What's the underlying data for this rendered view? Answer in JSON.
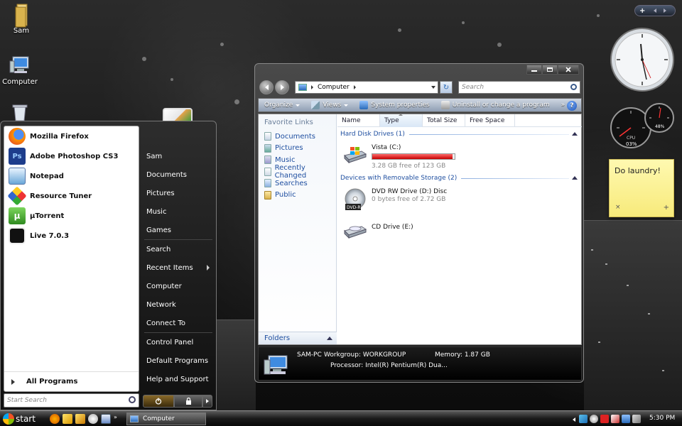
{
  "desktop": {
    "icons": [
      {
        "label": "Sam"
      },
      {
        "label": "Computer"
      }
    ]
  },
  "start_menu": {
    "pinned": [
      {
        "label": "Mozilla Firefox",
        "icon": "firefox-icon",
        "color": "#e66000"
      },
      {
        "label": "Adobe Photoshop CS3",
        "icon": "photoshop-icon",
        "color": "#1d3d8c"
      },
      {
        "label": "Notepad",
        "icon": "notepad-icon",
        "color": "#6aa7d8"
      },
      {
        "label": "Resource Tuner",
        "icon": "resource-tuner-icon",
        "color": "#d33"
      },
      {
        "label": "µTorrent",
        "icon": "utorrent-icon",
        "color": "#4ba23a"
      },
      {
        "label": "Live 7.0.3",
        "icon": "live-icon",
        "color": "#111111"
      }
    ],
    "all_programs": "All Programs",
    "search_placeholder": "Start Search",
    "right": {
      "user": "Sam",
      "group1": [
        "Documents",
        "Pictures",
        "Music",
        "Games"
      ],
      "group2": [
        "Search",
        "Recent Items",
        "Computer",
        "Network",
        "Connect To"
      ],
      "group3": [
        "Control Panel",
        "Default Programs",
        "Help and Support"
      ]
    }
  },
  "explorer": {
    "address": "Computer",
    "search_placeholder": "Search",
    "toolbar": {
      "organize": "Organize",
      "views": "Views",
      "system_properties": "System properties",
      "uninstall": "Uninstall or change a program",
      "help": "?"
    },
    "nav": {
      "title": "Favorite Links",
      "items": [
        "Documents",
        "Pictures",
        "Music",
        "Recently Changed",
        "Searches",
        "Public"
      ],
      "folders": "Folders"
    },
    "columns": [
      "Name",
      "Type",
      "Total Size",
      "Free Space"
    ],
    "groups": {
      "hdd": "Hard Disk Drives (1)",
      "removable": "Devices with Removable Storage (2)"
    },
    "drives": {
      "c": {
        "name": "Vista (C:)",
        "sub": "3.28 GB free of 123 GB",
        "used_fraction": 0.973
      },
      "d": {
        "name": "DVD RW Drive (D:) Disc",
        "sub": "0 bytes free of 2.72 GB",
        "badge": "DVD-R"
      },
      "e": {
        "name": "CD Drive (E:)"
      }
    },
    "details": {
      "pc_name": "SAM-PC",
      "workgroup": "Workgroup: WORKGROUP",
      "memory": "Memory: 1.87 GB",
      "processor": "Processor: Intel(R) Pentium(R) Dua..."
    }
  },
  "gadgets": {
    "bar_plus": "+",
    "meter": {
      "cpu_label": "CPU",
      "cpu_value": "03%",
      "mem_value": "48%"
    },
    "sticky_note": "Do laundry!",
    "sticky_close": "×",
    "sticky_add": "+"
  },
  "taskbar": {
    "start": "start",
    "task": "Computer",
    "time": "5:30 PM"
  },
  "colors": {
    "link_blue": "#1f4fa0",
    "bar_red": "#c40000",
    "sticky_yellow": "#fff9b0"
  }
}
